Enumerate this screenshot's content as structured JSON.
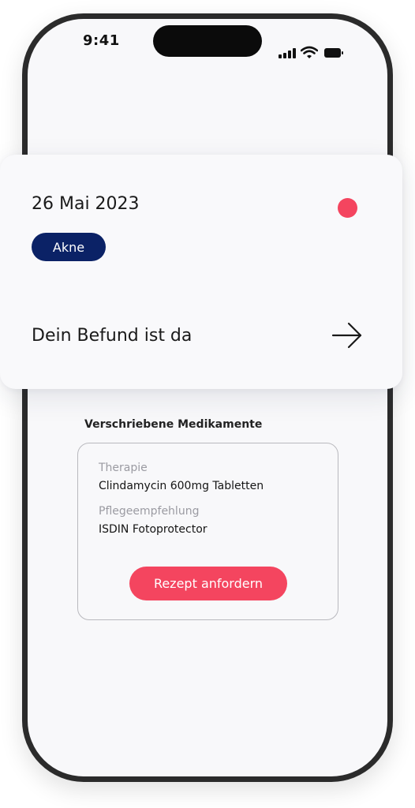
{
  "status_bar": {
    "time": "9:41"
  },
  "card": {
    "date": "26 Mai 2023",
    "tag": "Akne",
    "message": "Dein Befund ist da",
    "status_dot_color": "#f4455f",
    "tag_color": "#0b2266"
  },
  "medications": {
    "section_title": "Verschriebene Medikamente",
    "therapy_label": "Therapie",
    "therapy_value": "Clindamycin 600mg Tabletten",
    "care_label": "Pflegeempfehlung",
    "care_value": "ISDIN Fotoprotector",
    "button_label": "Rezept anfordern",
    "button_color": "#f4455f"
  },
  "icons": {
    "signal": "cellular-signal-icon",
    "wifi": "wifi-icon",
    "battery": "battery-icon",
    "arrow": "arrow-right-icon"
  }
}
